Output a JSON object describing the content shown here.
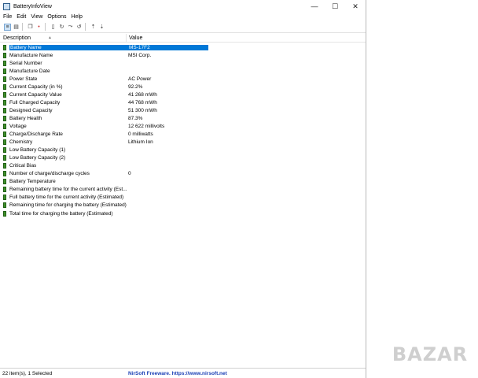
{
  "window": {
    "title": "BatteryInfoView",
    "controls": {
      "minimize": "—",
      "maximize": "☐",
      "close": "✕"
    }
  },
  "menu": [
    "File",
    "Edit",
    "View",
    "Options",
    "Help"
  ],
  "toolbar": [
    "properties-icon",
    "save-icon",
    "copy-icon",
    "refresh-icon",
    "html-report-icon",
    "battery-log-icon",
    "info-icon",
    "exit-icon"
  ],
  "columns": {
    "description": "Description",
    "value": "Value"
  },
  "rows": [
    {
      "desc": "Battery Name",
      "value": "MS-17F2",
      "selected": true
    },
    {
      "desc": "Manufacture Name",
      "value": "MSI Corp."
    },
    {
      "desc": "Serial Number",
      "value": ""
    },
    {
      "desc": "Manufacture Date",
      "value": ""
    },
    {
      "desc": "Power State",
      "value": "AC Power"
    },
    {
      "desc": "Current Capacity (in %)",
      "value": "92.2%"
    },
    {
      "desc": "Current Capacity Value",
      "value": "41 268 mWh"
    },
    {
      "desc": "Full Charged Capacity",
      "value": "44 768 mWh"
    },
    {
      "desc": "Designed Capacity",
      "value": "51 300 mWh"
    },
    {
      "desc": "Battery Health",
      "value": "87.3%"
    },
    {
      "desc": "Voltage",
      "value": "12 622 millivolts"
    },
    {
      "desc": "Charge/Discharge Rate",
      "value": "0 milliwatts"
    },
    {
      "desc": "Chemistry",
      "value": "Lithium Ion"
    },
    {
      "desc": "Low Battery Capacity (1)",
      "value": ""
    },
    {
      "desc": "Low Battery Capacity (2)",
      "value": ""
    },
    {
      "desc": "Critical Bias",
      "value": ""
    },
    {
      "desc": "Number of charge/discharge cycles",
      "value": "0"
    },
    {
      "desc": "Battery Temperature",
      "value": ""
    },
    {
      "desc": "Remaining battery time for the current activity (Est...",
      "value": ""
    },
    {
      "desc": "Full battery time for the current activity (Estimated)",
      "value": ""
    },
    {
      "desc": "Remaining time for charging the battery (Estimated)",
      "value": ""
    },
    {
      "desc": "Total  time for charging the battery (Estimated)",
      "value": ""
    }
  ],
  "status": {
    "items": "22 item(s), 1 Selected",
    "credit": "NirSoft Freeware. https://www.nirsoft.net"
  },
  "watermark": "BAZAR",
  "colors": {
    "selection": "#0078d7",
    "credit": "#1a3fb5",
    "battery_icon": "#3f8f2a"
  }
}
